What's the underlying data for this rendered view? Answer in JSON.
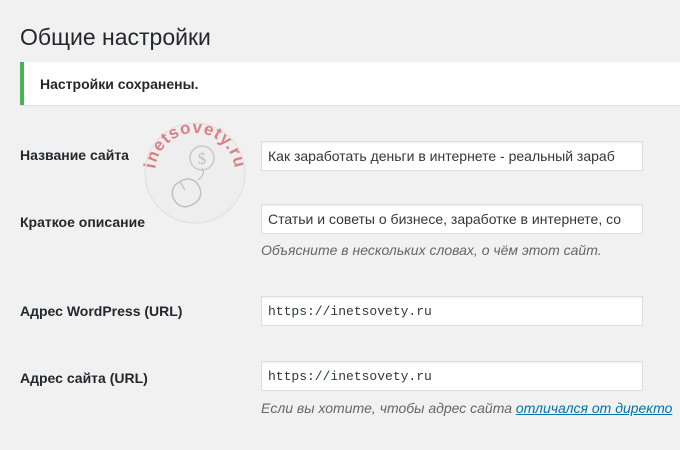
{
  "page": {
    "title": "Общие настройки"
  },
  "notice": {
    "text": "Настройки сохранены.",
    "color": "#46b450"
  },
  "settings": {
    "site_title": {
      "label": "Название сайта",
      "value": "Как заработать деньги в интернете - реальный зараб"
    },
    "tagline": {
      "label": "Краткое описание",
      "value": "Статьи и советы о бизнесе, заработке в интернете, со",
      "description": "Объясните в нескольких словах, о чём этот сайт."
    },
    "wp_url": {
      "label": "Адрес WordPress (URL)",
      "value": "https://inetsovety.ru"
    },
    "site_url": {
      "label": "Адрес сайта (URL)",
      "value": "https://inetsovety.ru",
      "description_prefix": "Если вы хотите, чтобы адрес сайта ",
      "description_link": "отличался от директо"
    }
  },
  "watermark": {
    "text": "inetsovety.ru",
    "symbol": "$",
    "icon": "mouse-dollar-logo",
    "color": "#c9242b"
  },
  "colors": {
    "background": "#f1f1f1",
    "link": "#0073aa"
  }
}
